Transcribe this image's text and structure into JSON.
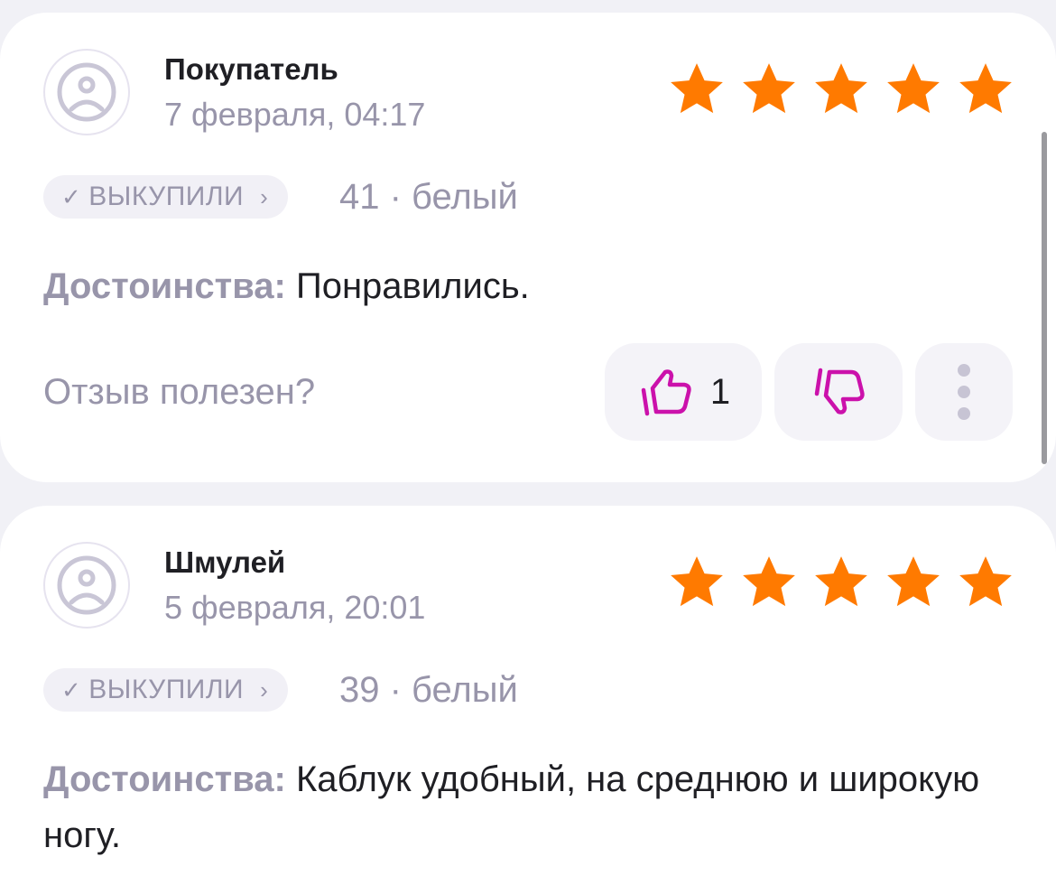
{
  "colors": {
    "background": "#f1f1f6",
    "card": "#ffffff",
    "star": "#ff7a00",
    "muted_text": "#9895aa",
    "vote_icon": "#cb11ab"
  },
  "reviews": [
    {
      "author": "Покупатель",
      "date": "7 февраля, 04:17",
      "rating": 5,
      "badge_label": "ВЫКУПИЛИ",
      "badge_check_icon": "check-icon",
      "badge_chevron_icon": "chevron-right-icon",
      "variant": "41 · белый",
      "pros_label": "Достоинства:",
      "pros_text": " Понравились.",
      "helpful_question": "Отзыв полезен?",
      "likes": "1"
    },
    {
      "author": "Шмулей",
      "date": "5 февраля, 20:01",
      "rating": 5,
      "badge_label": "ВЫКУПИЛИ",
      "badge_check_icon": "check-icon",
      "badge_chevron_icon": "chevron-right-icon",
      "variant": "39 · белый",
      "pros_label": "Достоинства:",
      "pros_text": " Каблук удобный, на среднюю и широкую ногу."
    }
  ]
}
